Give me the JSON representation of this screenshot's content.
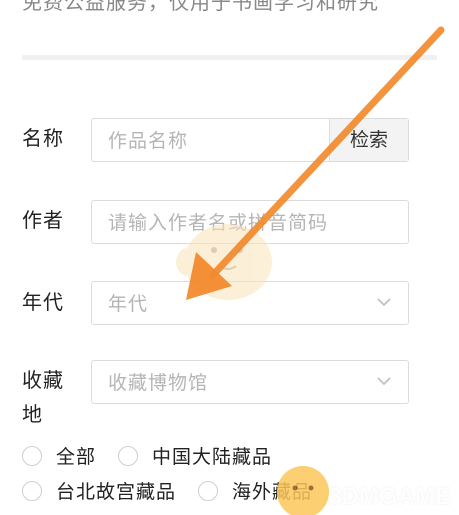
{
  "header": {
    "note": "免费公益服务，仅用于书画学习和研究"
  },
  "form": {
    "work_name": {
      "label": "名称",
      "placeholder": "作品名称",
      "search_label": "检索"
    },
    "author": {
      "label": "作者",
      "placeholder": "请输入作者名或拼音简码"
    },
    "era": {
      "label": "年代",
      "placeholder": "年代"
    },
    "collection": {
      "label_line1": "收藏",
      "label_line2": "地",
      "placeholder": "收藏博物馆"
    }
  },
  "radios": {
    "all": "全部",
    "mainland": "中国大陆藏品",
    "taipei": "台北故宫藏品",
    "overseas": "海外藏品"
  },
  "watermark": {
    "text": "3DMGAME"
  },
  "colors": {
    "arrow": "#f28a2e",
    "border": "#dcdcdc",
    "placeholder": "#b5b5b5"
  }
}
